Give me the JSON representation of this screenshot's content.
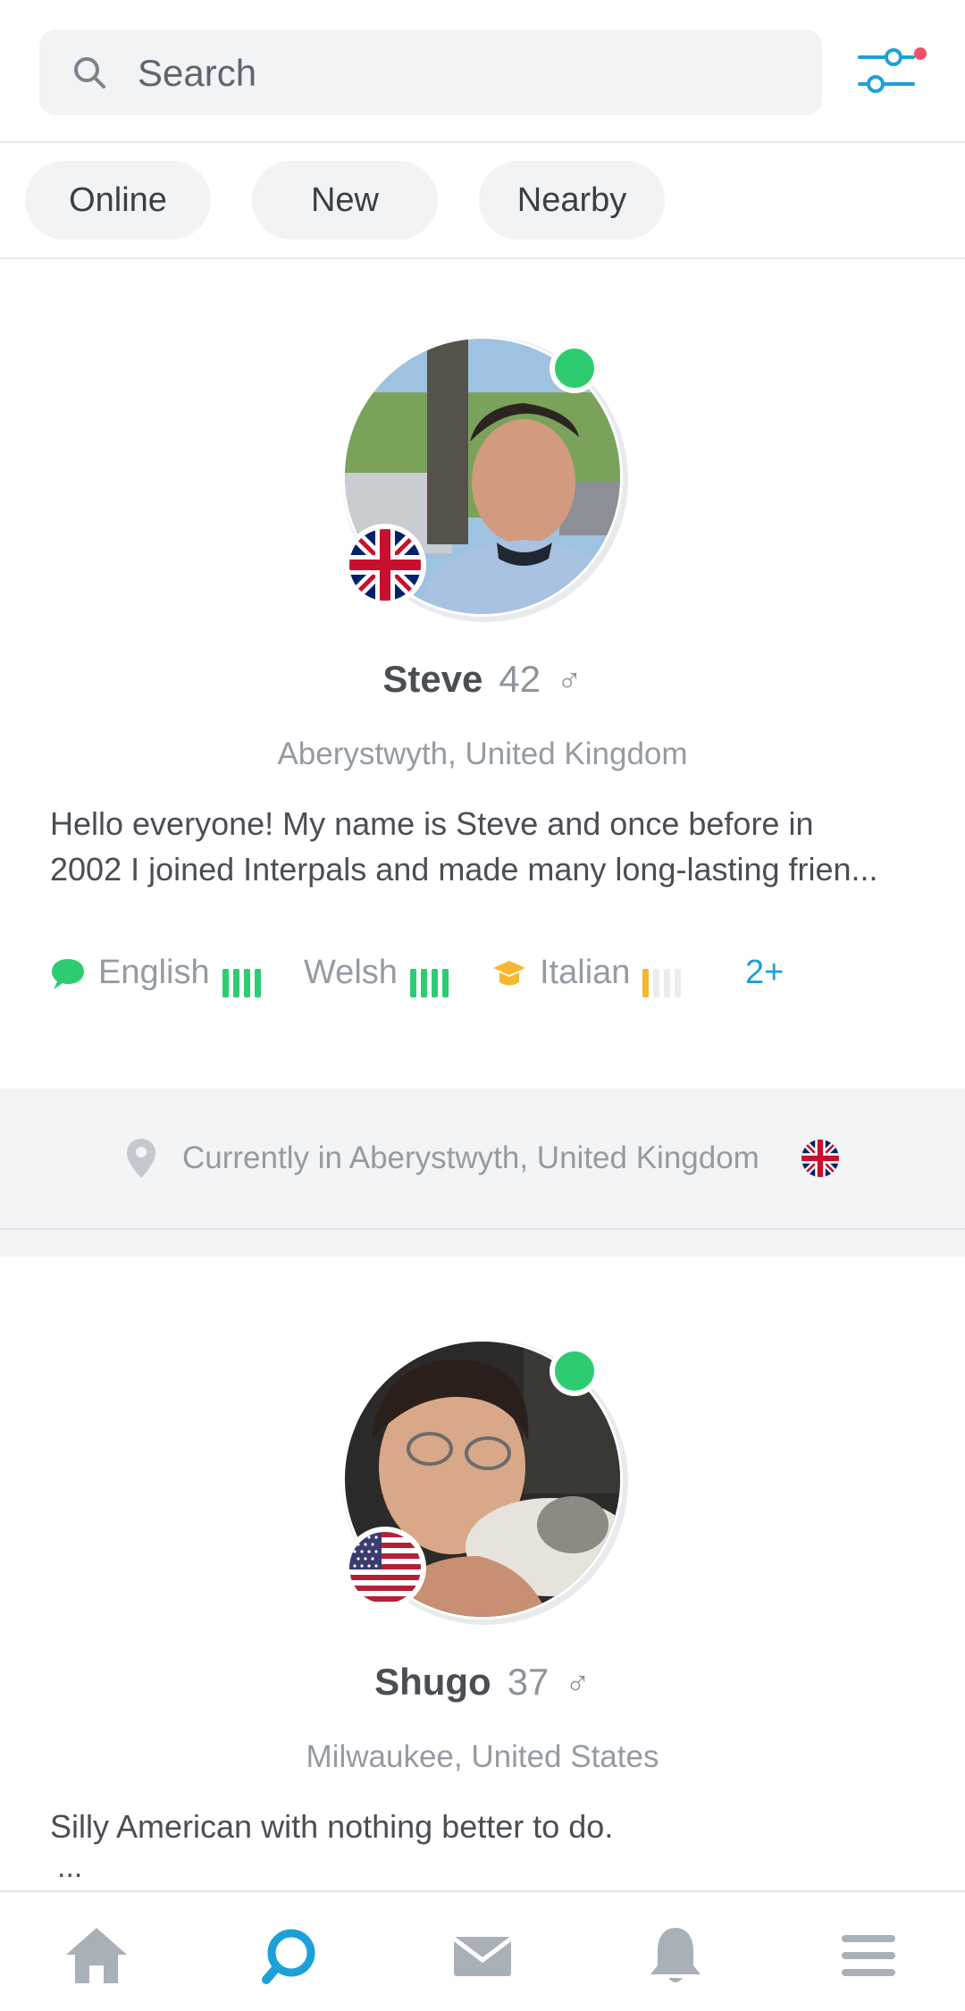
{
  "search": {
    "placeholder": "Search"
  },
  "filters": {
    "has_notification": true,
    "accent": "#1ba1d8",
    "dot_color": "#f0506e"
  },
  "chips": [
    {
      "label": "Online"
    },
    {
      "label": "New"
    },
    {
      "label": "Nearby"
    }
  ],
  "profiles": [
    {
      "name": "Steve",
      "age": "42",
      "gender_symbol": "♂",
      "location": "Aberystwyth, United Kingdom",
      "bio_line1": "Hello everyone!  My name is Steve and once before in",
      "bio_line2": "2002 I joined Interpals and made many long-lasting frien...",
      "online": true,
      "flag": "uk-flag",
      "languages": [
        {
          "icon": "speech-bubble-icon",
          "name": "English",
          "level": 4,
          "color": "#2ecc71"
        },
        {
          "icon": "",
          "name": "Welsh",
          "level": 4,
          "color": "#2ecc71"
        },
        {
          "icon": "graduation-cap-icon",
          "name": "Italian",
          "level": 1,
          "color": "#f5b82e"
        }
      ],
      "more_languages": "2+",
      "currently_in": "Currently in Aberystwyth, United Kingdom"
    },
    {
      "name": "Shugo",
      "age": "37",
      "gender_symbol": "♂",
      "location": "Milwaukee, United States",
      "bio_line1": "Silly American with nothing better to do.",
      "bio_line2": "...",
      "online": true,
      "flag": "us-flag"
    }
  ],
  "nav": [
    {
      "icon": "home-icon",
      "active": false
    },
    {
      "icon": "search-icon",
      "active": true
    },
    {
      "icon": "mail-icon",
      "active": false
    },
    {
      "icon": "bell-icon",
      "active": false
    },
    {
      "icon": "menu-icon",
      "active": false
    }
  ],
  "colors": {
    "online": "#2ecc71",
    "active_nav": "#1ba1d8",
    "inactive_nav": "#aab0b8"
  }
}
